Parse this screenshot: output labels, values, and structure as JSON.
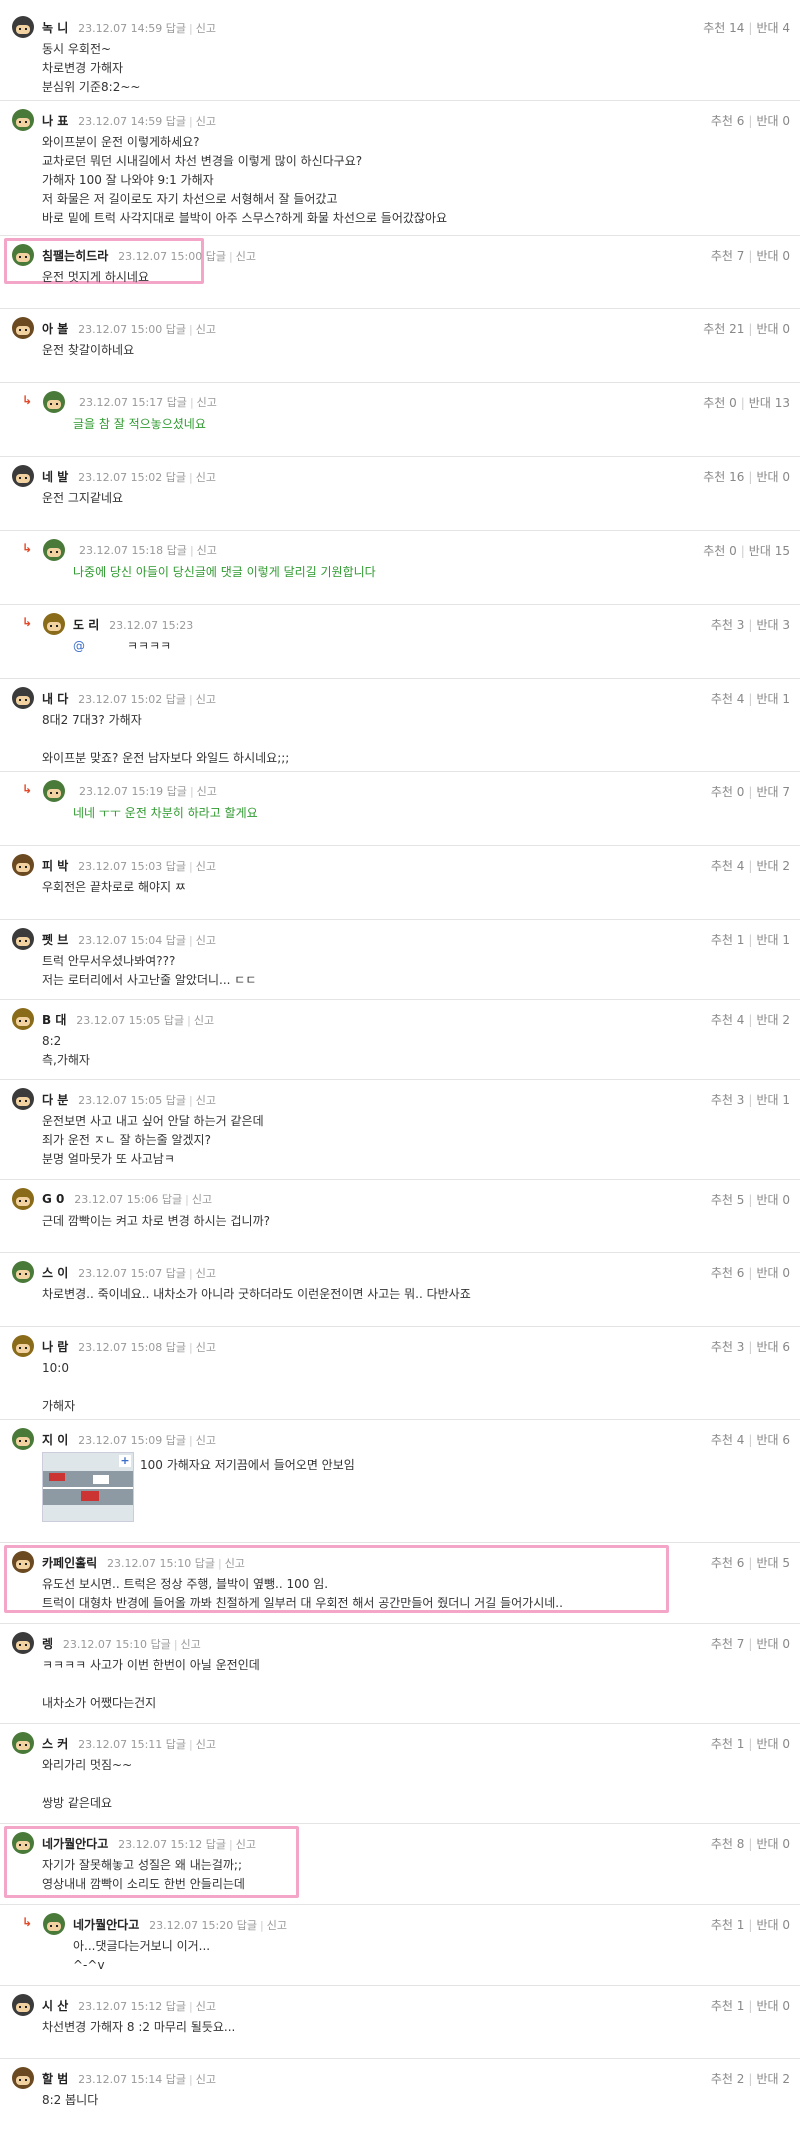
{
  "reply_label": "답글",
  "report_label": "신고",
  "up_label": "추천",
  "down_label": "반대",
  "comments": [
    {
      "nick": "녹          니",
      "time": "23.12.07 14:59",
      "up": "14",
      "down": "4",
      "body": "동시 우회전~\n차로변경 가해자\n분심위 기준8:2~~"
    },
    {
      "nick": "나      표",
      "time": "23.12.07 14:59",
      "up": "6",
      "down": "0",
      "body": "와이프분이 운전 이렇게하세요?\n교차로던 뭐던 시내길에서 차선 변경을 이렇게 많이 하신다구요?\n가해자 100 잘 나와야 9:1 가해자\n저 화물은 저 길이로도 자기 차선으로 서형해서 잘 들어갔고\n바로 밑에 트럭 사각지대로 블박이 아주 스무스?하게 화물 차선으로 들어갔잖아요"
    },
    {
      "nick": "침팰는히드라",
      "time": "23.12.07 15:00",
      "up": "7",
      "down": "0",
      "body": "운전 멋지게 하시네요"
    },
    {
      "nick": "아    볼",
      "time": "23.12.07 15:00",
      "up": "21",
      "down": "0",
      "body": "운전 찾갈이하네요"
    },
    {
      "nick": "",
      "time": "23.12.07 15:17",
      "up": "0",
      "down": "13",
      "body": "글을 참 잘 적으놓으셨네요"
    },
    {
      "nick": "네       발",
      "time": "23.12.07 15:02",
      "up": "16",
      "down": "0",
      "body": "운전 그지같네요"
    },
    {
      "nick": "",
      "time": "23.12.07 15:18",
      "up": "0",
      "down": "15",
      "body": "나중에 당신 아들이 당신글에 댓글 이렇게 달리길 기원합니다"
    },
    {
      "nick": "도          리",
      "time": "23.12.07 15:23",
      "up": "3",
      "down": "3",
      "mention": "@",
      "body": "ㅋㅋㅋㅋ"
    },
    {
      "nick": "내                  다",
      "time": "23.12.07 15:02",
      "up": "4",
      "down": "1",
      "body": "8대2 7대3? 가해자\n\n와이프분 맞죠? 운전 남자보다 와일드 하시네요;;;"
    },
    {
      "nick": "",
      "time": "23.12.07 15:19",
      "up": "0",
      "down": "7",
      "body": "네네 ㅜㅜ 운전 차분히 하라고 할게요"
    },
    {
      "nick": "피          박",
      "time": "23.12.07 15:03",
      "up": "4",
      "down": "2",
      "body": "우회전은 끝차로로 해야지 ㅉ"
    },
    {
      "nick": "펫    브",
      "time": "23.12.07 15:04",
      "up": "1",
      "down": "1",
      "body": "트럭 안무서우셨나봐여???\n저는 로터리에서 사고난줄 알았더니... ㄷㄷ"
    },
    {
      "nick": "B       대",
      "time": "23.12.07 15:05",
      "up": "4",
      "down": "2",
      "body": "8:2\n측,가해자"
    },
    {
      "nick": "다             분",
      "time": "23.12.07 15:05",
      "up": "3",
      "down": "1",
      "body": "운전보면 사고 내고 싶어 안달 하는거 같은데\n죄가 운전 ㅈㄴ 잘 하는줄 알겠지?\n분명 얼마뭇가 또 사고남ㅋ"
    },
    {
      "nick": "G      0",
      "time": "23.12.07 15:06",
      "up": "5",
      "down": "0",
      "body": "근데 깜빡이는 켜고 차로 변경 하시는 겁니까?"
    },
    {
      "nick": "스       이",
      "time": "23.12.07 15:07",
      "up": "6",
      "down": "0",
      "body": "차로변경.. 죽이네요.. 내차소가 아니라 굿하더라도 이런운전이면 사고는 뭐.. 다반사죠"
    },
    {
      "nick": "나                                           람",
      "time": "23.12.07 15:08",
      "up": "3",
      "down": "6",
      "body": "10:0\n\n가해자"
    },
    {
      "nick": "지               이",
      "time": "23.12.07 15:09",
      "up": "4",
      "down": "6",
      "body": "100 가해자요 저기끔에서 들어오면 안보임"
    },
    {
      "nick": "카페인홀릭",
      "time": "23.12.07 15:10",
      "up": "6",
      "down": "5",
      "body": "유도선 보시면.. 트럭은 정상 주행, 블박이 옆뺑.. 100 임.\n트럭이 대형차 반경에 들어올 까봐 친절하게 일부러 대 우회전 해서 공간만들어 줬더니 거길 들어가시네.."
    },
    {
      "nick": "렝",
      "time": "23.12.07 15:10",
      "up": "7",
      "down": "0",
      "body": "ㅋㅋㅋㅋ 사고가 이번 한번이 아닐 운전인데\n\n내차소가 어쨌다는건지"
    },
    {
      "nick": "스       커",
      "time": "23.12.07 15:11",
      "up": "1",
      "down": "0",
      "body": "와리가리 멋짐~~\n\n쌍방 같은데요"
    },
    {
      "nick": "네가뭘안다고",
      "time": "23.12.07 15:12",
      "up": "8",
      "down": "0",
      "body": "자기가 잘못해놓고 성질은 왜 내는걸까;;\n영상내내 깜빡이 소리도 한번 안들리는데"
    },
    {
      "nick": "네가뭘안다고",
      "time": "23.12.07 15:20",
      "up": "1",
      "down": "0",
      "body": "아...댓글다는거보니 이거...\n^-^v"
    },
    {
      "nick": "시          산",
      "time": "23.12.07 15:12",
      "up": "1",
      "down": "0",
      "body": "차선변경 가해자 8 :2 마무리 될듯요..."
    },
    {
      "nick": "할    범",
      "time": "23.12.07 15:14",
      "up": "2",
      "down": "2",
      "body": "8:2 봅니다"
    }
  ]
}
